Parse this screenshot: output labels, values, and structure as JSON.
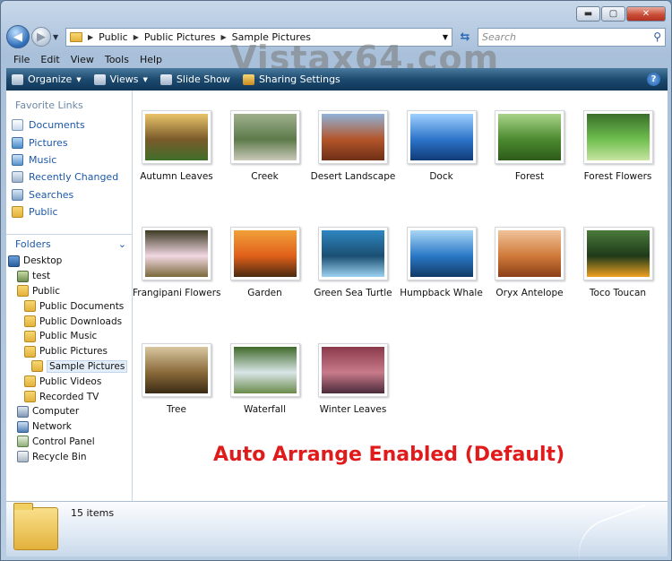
{
  "window": {
    "minimize": "▬",
    "maximize": "▢",
    "close": "✕"
  },
  "address": {
    "segments": [
      "Public",
      "Public Pictures",
      "Sample Pictures"
    ]
  },
  "search": {
    "placeholder": "Search"
  },
  "menu": [
    "File",
    "Edit",
    "View",
    "Tools",
    "Help"
  ],
  "watermark": "Vistax64.com",
  "toolbar": {
    "organize": "Organize",
    "views": "Views",
    "slideshow": "Slide Show",
    "sharing": "Sharing Settings",
    "help": "?"
  },
  "sidebar": {
    "favorites_heading": "Favorite Links",
    "favorites": [
      "Documents",
      "Pictures",
      "Music",
      "Recently Changed",
      "Searches",
      "Public"
    ],
    "folders_heading": "Folders",
    "tree": [
      {
        "label": "Desktop",
        "icon": "desktop-icon"
      },
      {
        "label": "test",
        "icon": "user-folder-icon"
      },
      {
        "label": "Public",
        "icon": "folder-icon"
      },
      {
        "label": "Public Documents",
        "icon": "folder-icon"
      },
      {
        "label": "Public Downloads",
        "icon": "folder-icon"
      },
      {
        "label": "Public Music",
        "icon": "folder-icon"
      },
      {
        "label": "Public Pictures",
        "icon": "folder-icon"
      },
      {
        "label": "Sample Pictures",
        "icon": "folder-icon"
      },
      {
        "label": "Public Videos",
        "icon": "folder-icon"
      },
      {
        "label": "Recorded TV",
        "icon": "folder-icon"
      },
      {
        "label": "Computer",
        "icon": "computer-icon"
      },
      {
        "label": "Network",
        "icon": "network-icon"
      },
      {
        "label": "Control Panel",
        "icon": "control-panel-icon"
      },
      {
        "label": "Recycle Bin",
        "icon": "recycle-bin-icon"
      }
    ]
  },
  "files": [
    {
      "name": "Autumn Leaves",
      "colors": [
        "#e9c46a",
        "#7a5a2a",
        "#3f6f2a"
      ]
    },
    {
      "name": "Creek",
      "colors": [
        "#9fb08c",
        "#5d7a4a",
        "#c9c9b8"
      ]
    },
    {
      "name": "Desert Landscape",
      "colors": [
        "#8fb3d9",
        "#b4552a",
        "#6d2f16"
      ]
    },
    {
      "name": "Dock",
      "colors": [
        "#9fd0ff",
        "#2d74c9",
        "#0f3b78"
      ]
    },
    {
      "name": "Forest",
      "colors": [
        "#a8d38a",
        "#4b8a2e",
        "#2d5a1a"
      ]
    },
    {
      "name": "Forest Flowers",
      "colors": [
        "#3a6f2a",
        "#6fbf4f",
        "#c7e3a1"
      ]
    },
    {
      "name": "Frangipani Flowers",
      "colors": [
        "#3d3a24",
        "#f1d7e2",
        "#7a6a3a"
      ]
    },
    {
      "name": "Garden",
      "colors": [
        "#f2a03a",
        "#e0601a",
        "#4a2a10"
      ]
    },
    {
      "name": "Green Sea Turtle",
      "colors": [
        "#2e86c1",
        "#1b4f72",
        "#9bd1f0"
      ]
    },
    {
      "name": "Humpback Whale",
      "colors": [
        "#a9d6f5",
        "#2a78c6",
        "#123a66"
      ]
    },
    {
      "name": "Oryx Antelope",
      "colors": [
        "#f0c29a",
        "#d07a3a",
        "#8a3f18"
      ]
    },
    {
      "name": "Toco Toucan",
      "colors": [
        "#4a7a3a",
        "#1e3a1a",
        "#f0a020"
      ]
    },
    {
      "name": "Tree",
      "colors": [
        "#d8c6a0",
        "#8a6a3a",
        "#3a2a14"
      ]
    },
    {
      "name": "Waterfall",
      "colors": [
        "#3f6a2a",
        "#d9e6e8",
        "#6a8a4a"
      ]
    },
    {
      "name": "Winter Leaves",
      "colors": [
        "#8a3a4a",
        "#c97a8a",
        "#4a2a3a"
      ]
    }
  ],
  "annotation": "Auto Arrange Enabled (Default)",
  "details": {
    "count": "15 items"
  }
}
